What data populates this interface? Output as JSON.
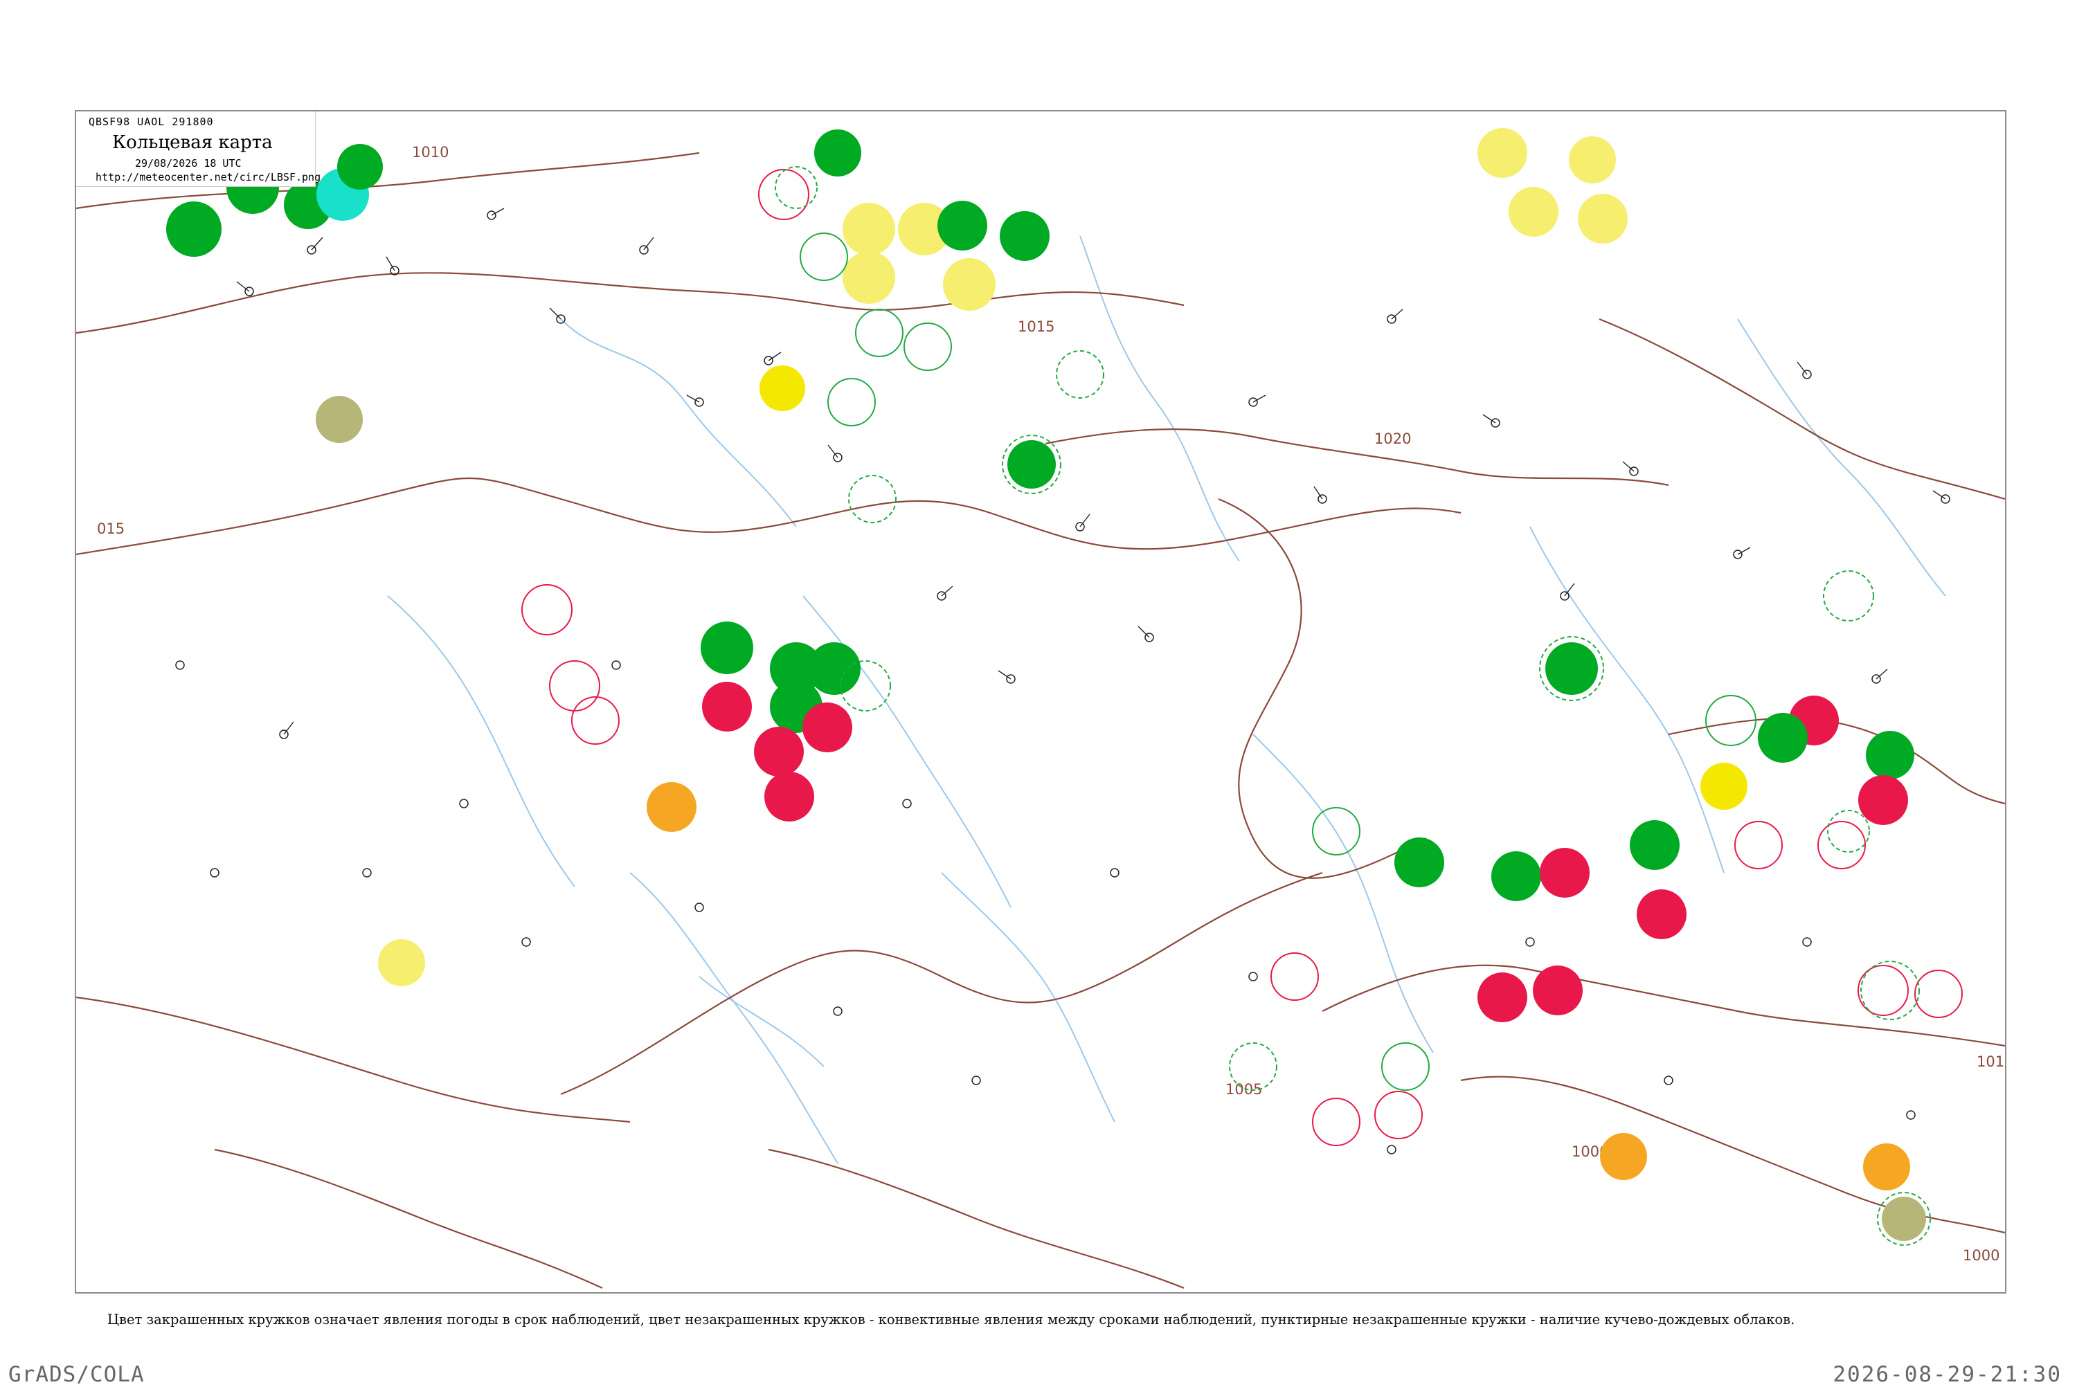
{
  "map": {
    "title_code": "QBSF98  UAOL  291800",
    "title": "Кольцевая карта",
    "datetime": "29/08/2026 18 UTC",
    "url": "http://meteocenter.net/circ/LBSF.png",
    "caption": "Цвет закрашенных кружков означает явления погоды в срок наблюдений, цвет незакрашенных кружков - конвективные явления между сроками наблюдений, пунктирные незакрашенные кружки - наличие кучево-дождевых облаков.",
    "footer_left": "GrADS/COLA",
    "footer_right": "2026-08-29-21:30",
    "colors": {
      "isobar": "#8b4a3a",
      "river": "#9ec8e8",
      "rain": "#00aa22",
      "thunder": "#e8194a",
      "fog": "#f5ee6e",
      "strong_yellow": "#f5e800",
      "orange": "#f5a623",
      "olive": "#b6b678",
      "cyan": "#19e0c8",
      "light_green": "#66e08a",
      "cb_dashed": "#22aa44"
    },
    "isobars": [
      {
        "label": "1010"
      },
      {
        "label": "1015"
      },
      {
        "label": "1020"
      },
      {
        "label": "1005"
      },
      {
        "label": "1000"
      },
      {
        "label": "015"
      },
      {
        "label": "101"
      },
      {
        "label": "1000"
      }
    ]
  }
}
